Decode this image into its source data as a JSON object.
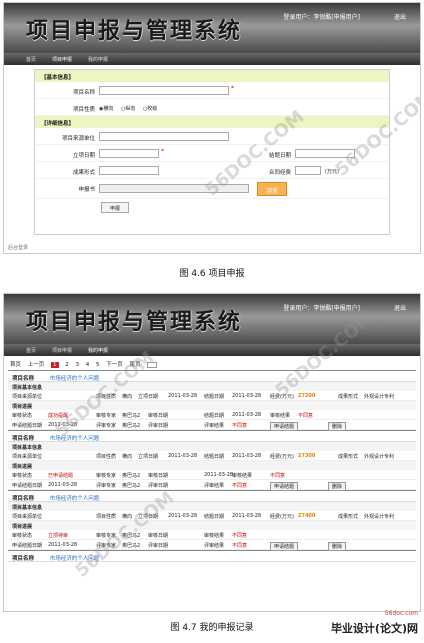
{
  "app": {
    "title": "项目申报与管理系统",
    "user": "登录用户：李锐酷[申报用户]",
    "logout": "退出"
  },
  "nav": [
    "首页",
    "项目申报",
    "我的申报"
  ],
  "form": {
    "section1": "【基本信息】",
    "project_name_label": "项目名称",
    "nature_label": "项目性质",
    "nature_options": [
      "◉横向",
      "○纵向",
      "○校级"
    ],
    "section2": "【详细信息】",
    "source_label": "项目来源单位",
    "start_label": "立项日期",
    "end_label": "结题日期",
    "form_label": "成果形式",
    "funding_label": "合同经费",
    "unit": "(万元)",
    "apply_label": "申报书",
    "browse": "浏览",
    "submit": "申报",
    "footnote": "后台登录"
  },
  "captions": {
    "fig1": "图 4.6 项目申报",
    "fig2": "图 4.7 我的申报记录"
  },
  "pager": {
    "first": "首页",
    "prev": "上一页",
    "pages": [
      "1",
      "2",
      "3",
      "4",
      "5"
    ],
    "next": "下一页",
    "last": "尾页"
  },
  "records": [
    {
      "name_label": "项目名称",
      "name": "市场经济的个人问题",
      "sub1": "项目基本信息",
      "line1": [
        "项目来源单位",
        "项目性质",
        "横向",
        "立项日期",
        "2011-03-28",
        "结题日期",
        "2011-03-28",
        "经费(万元)",
        "27200",
        "成果形式",
        "外观设计专利"
      ],
      "sub2": "项目进展",
      "line2": [
        "审核状态",
        "成功提醒",
        "审核专家",
        "奥巴马2",
        "审核日期",
        "结题日期",
        "2011-03-28",
        "审核结果",
        "不同意"
      ],
      "line3": [
        "申请结题日期",
        "2011-03-28",
        "评审专家",
        "奥巴马2",
        "评审日期",
        "评审结果",
        "不同意",
        "申请结题",
        "删除"
      ]
    },
    {
      "name_label": "项目名称",
      "name": "市场经济的个人问题",
      "sub1": "项目基本信息",
      "line1": [
        "项目来源单位",
        "项目性质",
        "横向",
        "立项日期",
        "2011-03-28",
        "结题日期",
        "2011-03-28",
        "经费(万元)",
        "27300",
        "成果形式",
        "外观设计专利"
      ],
      "sub2": "项目进展",
      "line2": [
        "审核状态",
        "已申请结题",
        "审核专家",
        "奥巴马2",
        "审核日期",
        "2011-03-28",
        "审核结果",
        "不同意"
      ],
      "line3": [
        "申请结题日期",
        "2011-03-28",
        "评审专家",
        "奥巴马2",
        "评审日期",
        "评审结果",
        "不同意",
        "申请结题",
        "删除"
      ]
    },
    {
      "name_label": "项目名称",
      "name": "市场经济的个人问题",
      "sub1": "项目基本信息",
      "line1": [
        "项目来源单位",
        "项目性质",
        "横向",
        "立项日期",
        "2011-03-28",
        "结题日期",
        "2011-03-28",
        "经费(万元)",
        "27400",
        "成果形式",
        "外观设计专利"
      ],
      "sub2": "项目进展",
      "line2": [
        "审核状态",
        "立项待审",
        "审核专家",
        "奥巴马2",
        "审核日期",
        "审核结果",
        "不同意"
      ],
      "line3": [
        "申请结题日期",
        "2011-03-28",
        "评审专家",
        "奥巴马2",
        "评审日期",
        "评审结果",
        "不同意",
        "申请结题",
        "删除"
      ]
    },
    {
      "name_label": "项目名称",
      "name": "市场经济的个人问题"
    }
  ],
  "watermark": "56DOC.COM",
  "logo": {
    "url": "56doc.com",
    "text": "毕业设计(论文)网"
  }
}
